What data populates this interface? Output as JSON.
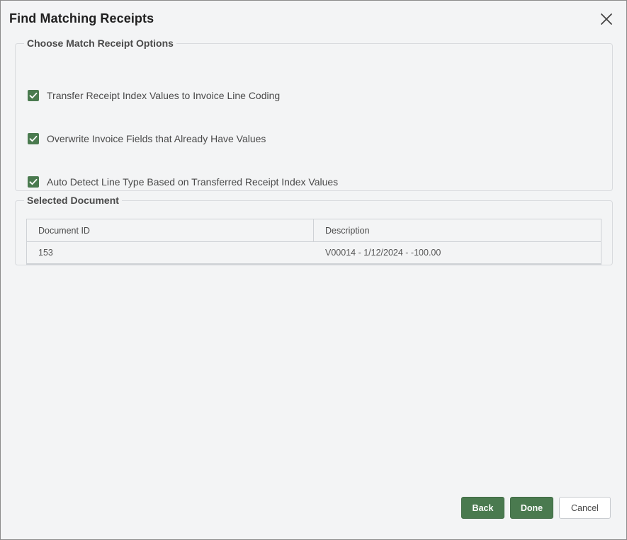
{
  "dialog": {
    "title": "Find Matching Receipts",
    "close_icon": "close-icon"
  },
  "options_group": {
    "legend": "Choose Match Receipt Options",
    "items": [
      {
        "label": "Transfer Receipt Index Values to Invoice Line Coding",
        "checked": true
      },
      {
        "label": "Overwrite Invoice Fields that Already Have Values",
        "checked": true
      },
      {
        "label": "Auto Detect Line Type Based on Transferred Receipt Index Values",
        "checked": true
      }
    ]
  },
  "selected_group": {
    "legend": "Selected Document",
    "columns": [
      "Document ID",
      "Description"
    ],
    "rows": [
      [
        "153",
        "V00014 - 1/12/2024 - -100.00"
      ]
    ]
  },
  "footer": {
    "back_label": "Back",
    "done_label": "Done",
    "cancel_label": "Cancel"
  },
  "colors": {
    "accent": "#4a7a4f",
    "background": "#f3f4f5"
  }
}
